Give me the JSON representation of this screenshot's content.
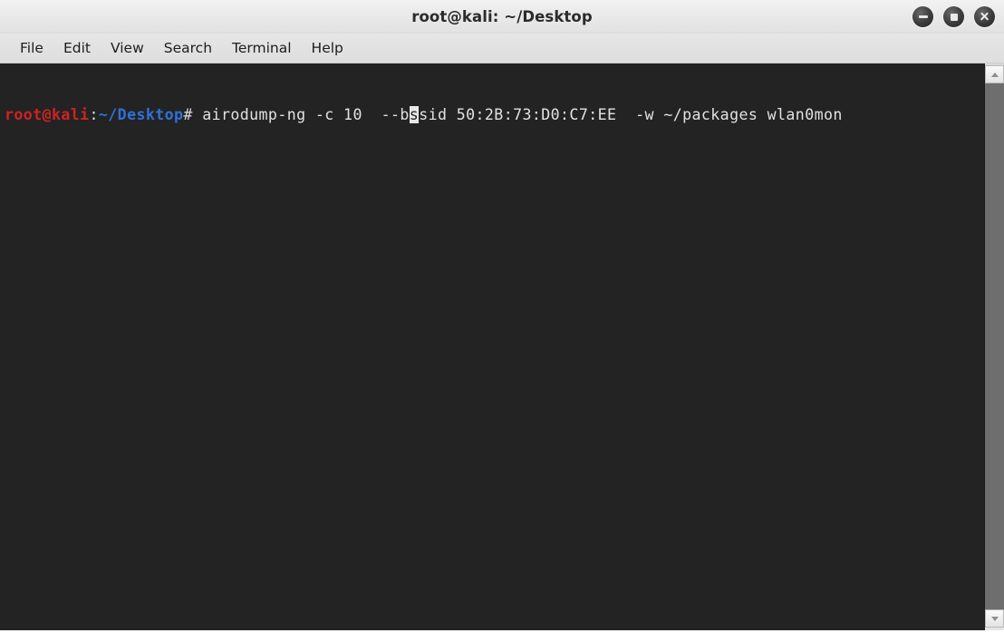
{
  "window": {
    "title": "root@kali: ~/Desktop",
    "controls": {
      "minimize_label": "Minimize",
      "maximize_label": "Maximize",
      "close_label": "Close"
    }
  },
  "menubar": {
    "items": [
      {
        "label": "File"
      },
      {
        "label": "Edit"
      },
      {
        "label": "View"
      },
      {
        "label": "Search"
      },
      {
        "label": "Terminal"
      },
      {
        "label": "Help"
      }
    ]
  },
  "terminal": {
    "background_color": "#232323",
    "foreground_color": "#d6d6d6",
    "prompt": {
      "user_host": "root@kali",
      "separator": ":",
      "path": "~/Desktop",
      "sigil": "# "
    },
    "command": {
      "before_cursor": "airodump-ng -c 10  --b",
      "cursor_char": "s",
      "after_cursor": "sid 50:2B:73:D0:C7:EE  -w ~/packages wlan0mon",
      "full_text": "airodump-ng -c 10  --bssid 50:2B:73:D0:C7:EE  -w ~/packages wlan0mon"
    },
    "colors": {
      "user_host": "#cf2222",
      "path": "#3070d8",
      "text": "#e2e2e2",
      "cursor_bg": "#e8e8e8"
    }
  },
  "scrollbar": {
    "up_label": "Scroll up",
    "down_label": "Scroll down"
  }
}
